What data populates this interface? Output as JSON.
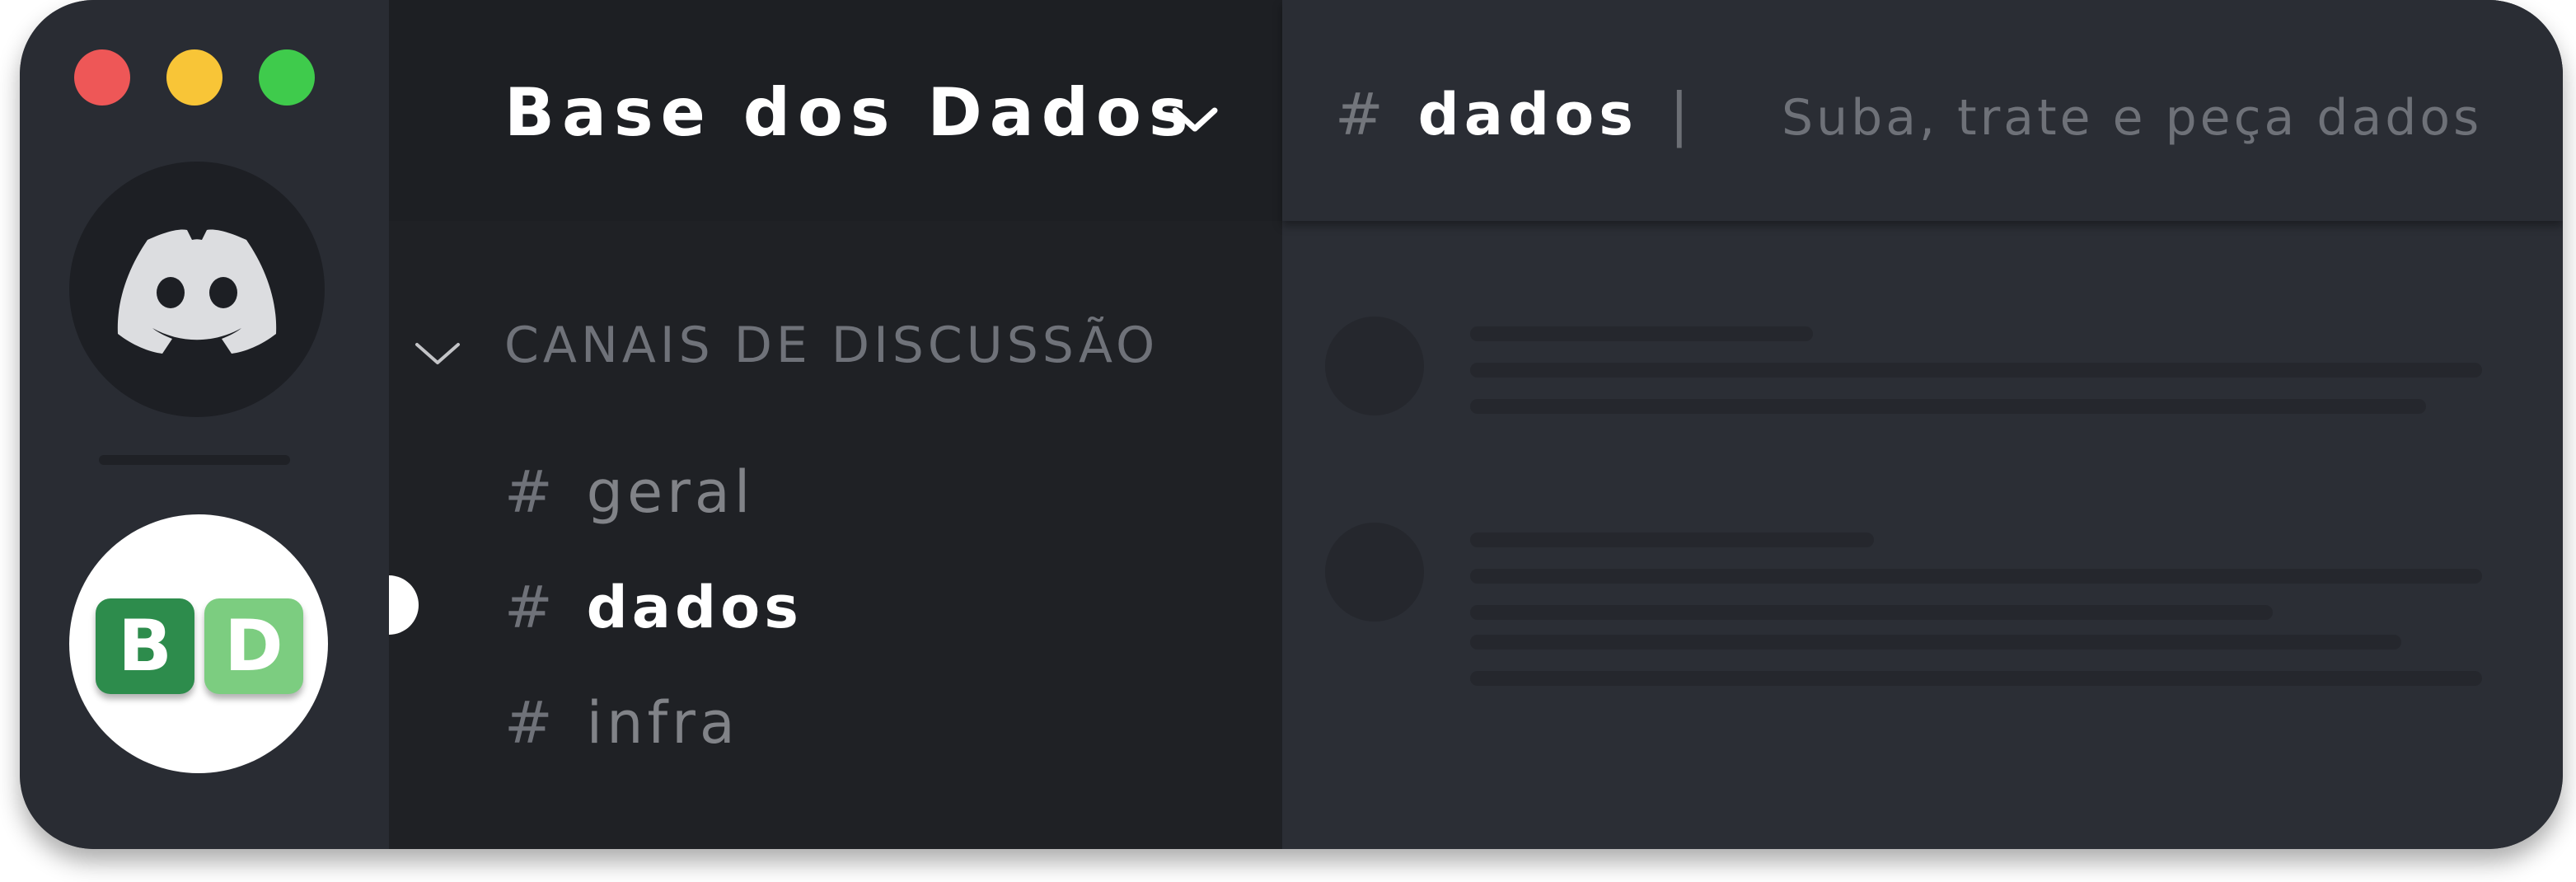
{
  "window": {
    "traffic_lights": [
      "#ee5757",
      "#f8c537",
      "#3fcb4c"
    ]
  },
  "rail": {
    "discord_icon": "discord-logo",
    "server_icon": {
      "tiles": [
        "B",
        "D"
      ],
      "colors": [
        "#2d8c4c",
        "#7ccd80"
      ]
    }
  },
  "server": {
    "name": "Base dos Dados"
  },
  "category": {
    "label": "CANAIS DE DISCUSSÃO"
  },
  "channels": [
    {
      "hash": "#",
      "name": "geral",
      "active": false
    },
    {
      "hash": "#",
      "name": "dados",
      "active": true
    },
    {
      "hash": "#",
      "name": "infra",
      "active": false
    }
  ],
  "main": {
    "hash": "#",
    "channel_name": "dados",
    "separator": "|",
    "topic": "Suba, trate e peça dados"
  },
  "colors": {
    "accent_white": "#ffffff",
    "background": "#2b2e35",
    "sidebar": "#1f2125"
  }
}
